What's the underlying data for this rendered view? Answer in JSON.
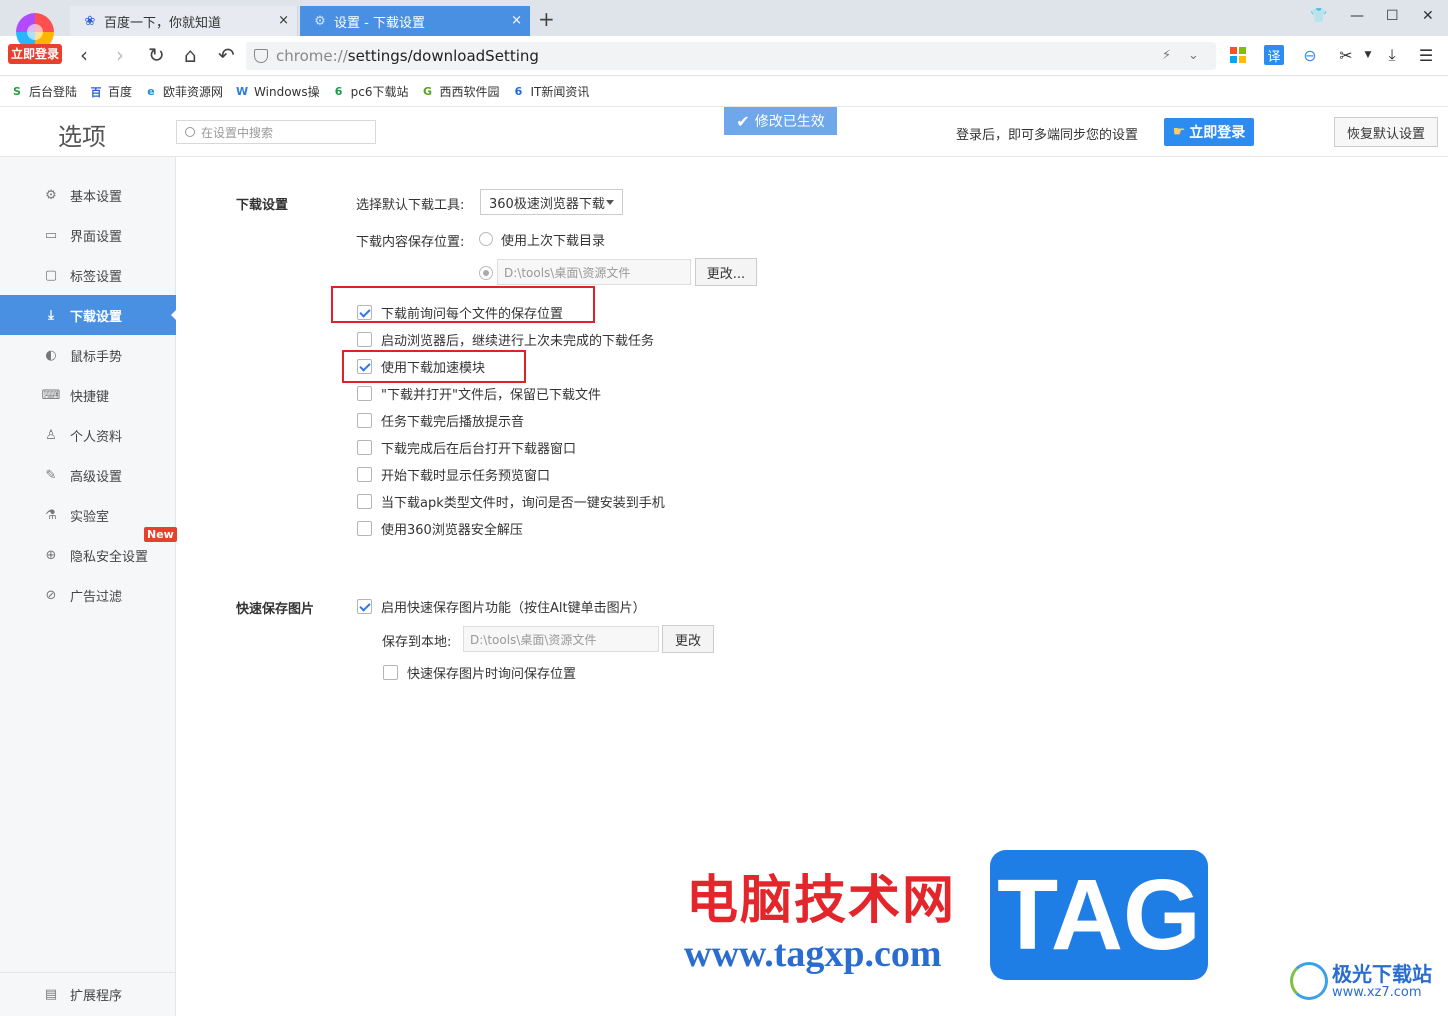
{
  "browser": {
    "login_badge": "立即登录",
    "tabs": [
      {
        "title": "百度一下，你就知道",
        "close": "×"
      },
      {
        "title": "设置 - 下载设置",
        "close": "×"
      }
    ],
    "new_tab": "+",
    "url_scheme": "chrome://",
    "url_path": "settings/downloadSetting",
    "translate_label": "译"
  },
  "bookmarks": [
    {
      "label": "后台登陆",
      "icon": "S",
      "color": "#2a9d3b"
    },
    {
      "label": "百度",
      "icon": "百",
      "color": "#2b5fd9"
    },
    {
      "label": "欧菲资源网",
      "icon": "e",
      "color": "#1f8ed8"
    },
    {
      "label": "Windows操",
      "icon": "W",
      "color": "#2b7bd9"
    },
    {
      "label": "pc6下载站",
      "icon": "6",
      "color": "#1b9a4b"
    },
    {
      "label": "西西软件园",
      "icon": "G",
      "color": "#57a42a"
    },
    {
      "label": "IT新闻资讯",
      "icon": "6",
      "color": "#1b6bd9"
    }
  ],
  "header": {
    "title": "选项",
    "search_placeholder": "在设置中搜索",
    "toast": "修改已生效",
    "sync_text": "登录后，即可多端同步您的设置",
    "login_button": "立即登录",
    "restore_button": "恢复默认设置"
  },
  "sidebar": {
    "items": [
      {
        "label": "基本设置",
        "icon": "gear-icon"
      },
      {
        "label": "界面设置",
        "icon": "window-icon"
      },
      {
        "label": "标签设置",
        "icon": "tab-icon"
      },
      {
        "label": "下载设置",
        "icon": "download-icon"
      },
      {
        "label": "鼠标手势",
        "icon": "mouse-icon"
      },
      {
        "label": "快捷键",
        "icon": "keyboard-icon"
      },
      {
        "label": "个人资料",
        "icon": "user-icon"
      },
      {
        "label": "高级设置",
        "icon": "wrench-icon"
      },
      {
        "label": "实验室",
        "icon": "flask-icon"
      },
      {
        "label": "隐私安全设置",
        "icon": "shield-plus-icon"
      },
      {
        "label": "广告过滤",
        "icon": "block-icon"
      }
    ],
    "active_index": 3,
    "new_badge": "New",
    "extensions": "扩展程序"
  },
  "download": {
    "section_title": "下载设置",
    "tool_label": "选择默认下载工具:",
    "tool_value": "360极速浏览器下载",
    "location_label": "下载内容保存位置:",
    "radio_last_dir": "使用上次下载目录",
    "path_value": "D:\\tools\\桌面\\资源文件",
    "change_button": "更改...",
    "options": [
      {
        "label": "下载前询问每个文件的保存位置",
        "checked": true
      },
      {
        "label": "启动浏览器后，继续进行上次未完成的下载任务",
        "checked": false
      },
      {
        "label": "使用下载加速模块",
        "checked": true
      },
      {
        "label": "\"下载并打开\"文件后，保留已下载文件",
        "checked": false
      },
      {
        "label": "任务下载完后播放提示音",
        "checked": false
      },
      {
        "label": "下载完成后在后台打开下载器窗口",
        "checked": false
      },
      {
        "label": "开始下载时显示任务预览窗口",
        "checked": false
      },
      {
        "label": "当下载apk类型文件时，询问是否一键安装到手机",
        "checked": false
      },
      {
        "label": "使用360浏览器安全解压",
        "checked": false
      }
    ]
  },
  "quick_save": {
    "section_title": "快速保存图片",
    "enable_label": "启用快速保存图片功能（按住Alt键单击图片）",
    "enable_checked": true,
    "save_label": "保存到本地:",
    "path_value": "D:\\tools\\桌面\\资源文件",
    "change_button": "更改",
    "ask_label": "快速保存图片时询问保存位置",
    "ask_checked": false
  },
  "watermark": {
    "cn_text": "电脑技术网",
    "url_text": "www.tagxp.com",
    "tag_text": "TAG",
    "jg_text": "极光下载站",
    "jg_url": "www.xz7.com"
  },
  "colors": {
    "accent": "#4a90e2",
    "highlight_border": "#e0212a",
    "new_badge": "#e8402e"
  }
}
